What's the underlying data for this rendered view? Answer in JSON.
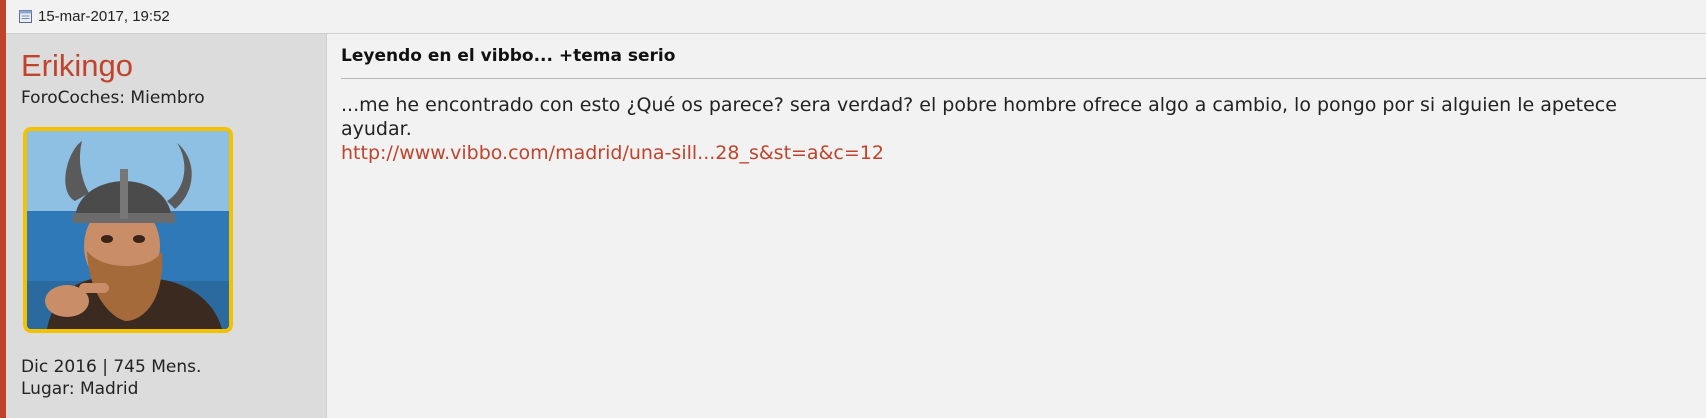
{
  "post": {
    "date": "15-mar-2017, 19:52",
    "date_icon": "document-icon",
    "accent_color": "#c0432b",
    "user": {
      "name": "Erikingo",
      "title": "ForoCoches: Miembro",
      "joined": "Dic 2016 | 745 Mens.",
      "location": "Lugar: Madrid",
      "avatar": "viking-avatar"
    },
    "title": "Leyendo en el vibbo... +tema serio",
    "text": "...me he encontrado con esto ¿Qué os parece? sera verdad? el pobre hombre ofrece algo a cambio, lo pongo por si alguien le apetece ayudar.",
    "link": "http://www.vibbo.com/madrid/una-sill...28_s&st=a&c=12"
  }
}
